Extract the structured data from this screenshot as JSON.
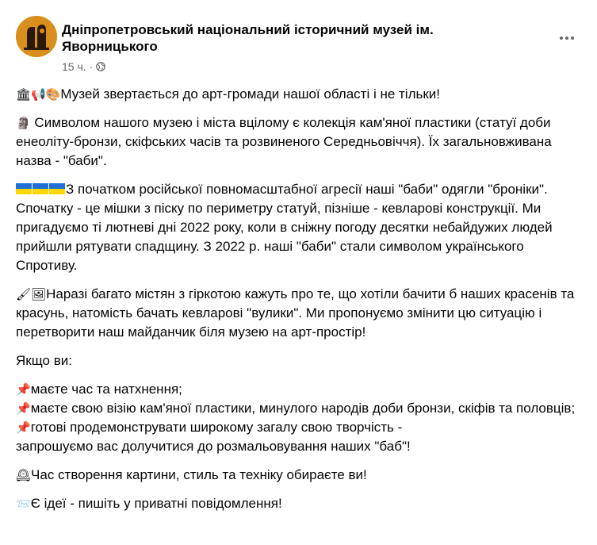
{
  "post": {
    "page_name": "Дніпропетровський національний історичний музей ім. Яворницького",
    "time": "15 ч.",
    "separator": "·"
  },
  "icons": {
    "more": "more-horizontal-icon",
    "privacy": "globe-icon"
  },
  "colors": {
    "accent_avatar": "#d98f1e",
    "meta": "#65676b",
    "text": "#050505"
  },
  "body": {
    "p1": "Музей звертається до арт-громади нашої області і не тільки!",
    "p2": "Символом нашого музею і міста вцілому є колекція кам'яної пластики (статуї доби енеоліту-бронзи, скіфських часів та розвиненого Середньовіччя). Їх загальновживана назва - \"баби\".",
    "p3": "З початком російської повномасштабної агресії наші \"баби\" одягли \"броніки\". Спочатку - це мішки з піску по периметру статуй, пізніше - кевларові конструкції. Ми пригадуємо ті лютневі дні 2022 року, коли в сніжну погоду десятки небайдужих людей прийшли рятувати спадщину. З 2022 р. наші \"баби\" стали символом українського Спротиву.",
    "p4": "Наразі багато містян з гіркотою кажуть про те, що хотіли бачити б наших красенів та красунь, натомість бачать кевларові \"вулики\". Ми пропонуємо змінити цю ситуацію і перетворити наш майданчик біля музею на арт-простір!",
    "p5": "Якщо ви:",
    "bullet1": "маєте час та натхнення;",
    "bullet2": "маєте свою візію кам'яної пластики, минулого народів доби бронзи, скіфів та половців;",
    "bullet3_line1": "готові продемонструвати широкому загалу свою творчість -",
    "bullet3_line2": "запрошуємо вас долучитися до розмальовування наших \"баб\"!",
    "p7": "Час створення картини, стиль та техніку обираєте ви!",
    "p8": "Є ідеї - пишіть у приватні повідомлення!"
  }
}
